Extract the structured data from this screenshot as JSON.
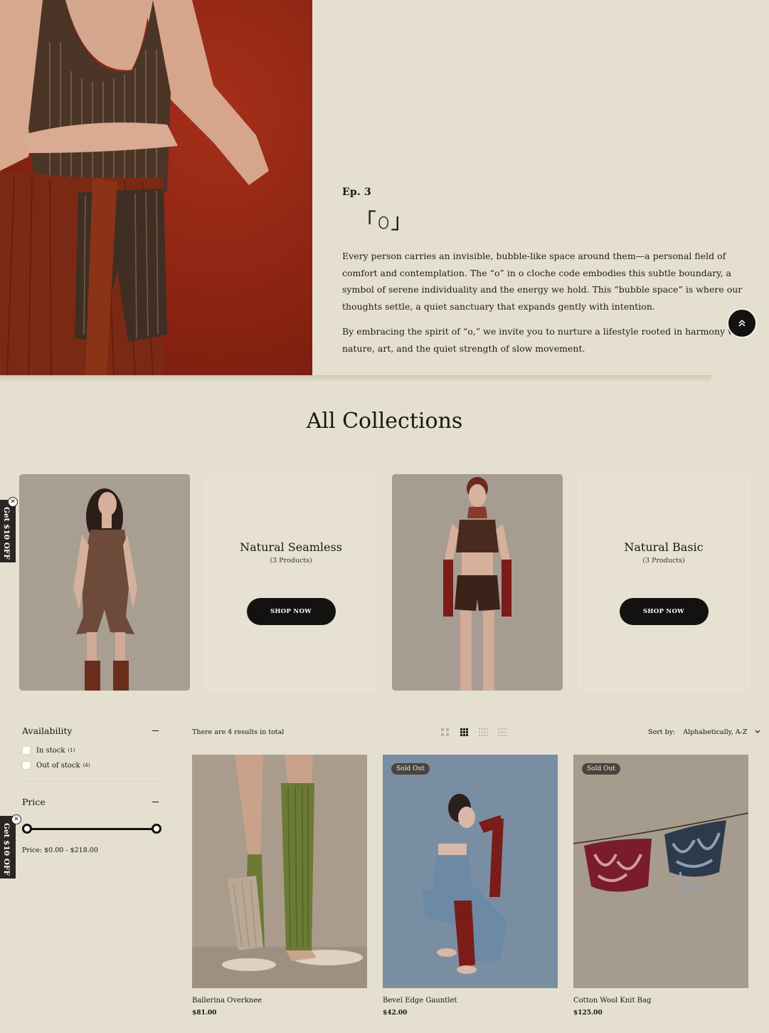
{
  "hero": {
    "episode": "Ep. 3",
    "symbol": "「o」",
    "paragraphs": [
      "Every person carries an invisible, bubble-like space around them—a personal field of comfort and contemplation. The “o” in o cloche code embodies this subtle boundary, a symbol of serene individuality and the energy we hold. This “bubble space” is where our thoughts settle, a quiet sanctuary that expands gently with intention.",
      "By embracing the spirit of “o,” we invite you to nurture a lifestyle rooted in harmony with nature, art, and the quiet strength of slow movement."
    ]
  },
  "collections": {
    "title": "All Collections",
    "cards": [
      {
        "title": "Natural Seamless",
        "count": "(3 Products)",
        "button": "SHOP NOW"
      },
      {
        "title": "Natural Basic",
        "count": "(3 Products)",
        "button": "SHOP NOW"
      }
    ]
  },
  "side_tabs": {
    "label": "Get $10 OFF",
    "close": "✕"
  },
  "filters": {
    "availability": {
      "title": "Availability",
      "options": [
        {
          "label": "In stock",
          "count": "(1)"
        },
        {
          "label": "Out of stock",
          "count": "(4)"
        }
      ]
    },
    "price": {
      "title": "Price",
      "range_text": "Price: $0.00 - $218.00",
      "min_fraction": 0,
      "max_fraction": 1
    }
  },
  "toolbar": {
    "results_text": "There are 4 results in total",
    "sort_label": "Sort by:",
    "sort_value": "Alphabetically, A-Z"
  },
  "products": [
    {
      "name": "Ballerina Overknee",
      "price": "$81.00",
      "badge": ""
    },
    {
      "name": "Bevel Edge Gauntlet",
      "price": "$42.00",
      "badge": "Sold Out"
    },
    {
      "name": "Cotton Wool Knit Bag",
      "price": "$125.00",
      "badge": "Sold Out"
    }
  ],
  "colors": {
    "background": "#e4dfcf",
    "button": "#141210",
    "hero_red": "#8a2312"
  },
  "icons": {
    "scroll_top": "double-chevron-up-icon",
    "sort_toggle": "chevron-down-icon"
  }
}
